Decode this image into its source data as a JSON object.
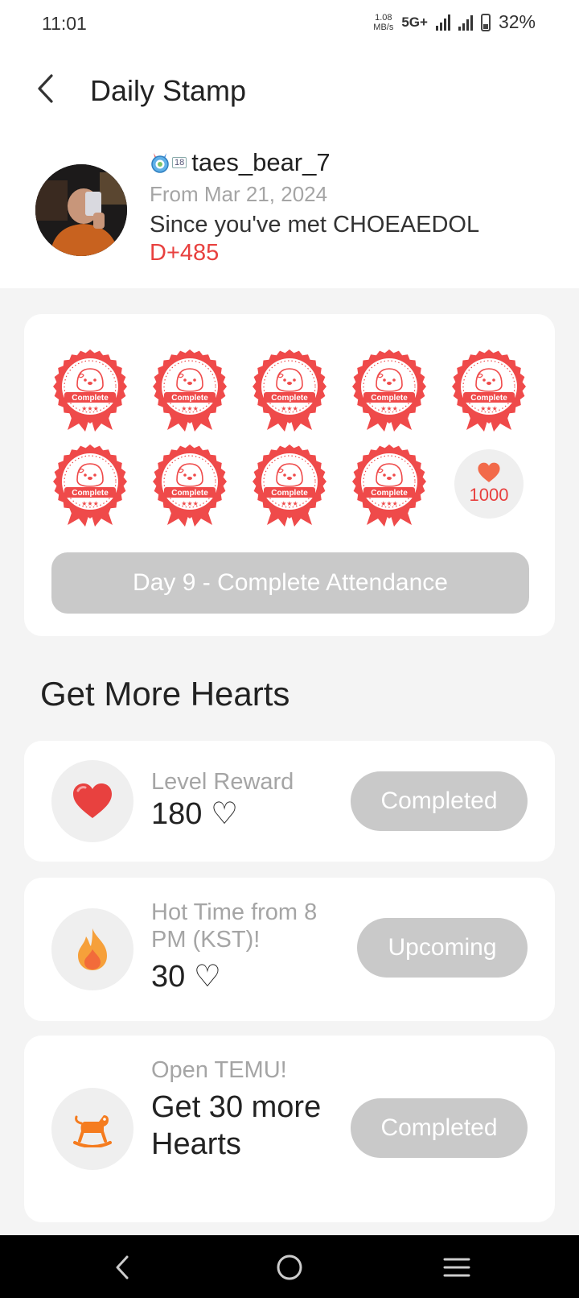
{
  "status": {
    "time": "11:01",
    "net_speed_value": "1.08",
    "net_speed_unit": "MB/s",
    "network": "5G+",
    "battery": "32%"
  },
  "header": {
    "title": "Daily Stamp"
  },
  "profile": {
    "level": "18",
    "username": "taes_bear_7",
    "from_date": "From Mar 21, 2024",
    "since_text": "Since you've met CHOEAEDOL",
    "dday": "D+485"
  },
  "stamps": {
    "label": "Complete",
    "completed_count": 9,
    "total": 10,
    "final_reward": "1000",
    "attend_button": "Day 9 - Complete Attendance"
  },
  "more_hearts": {
    "title": "Get More Hearts",
    "missions": [
      {
        "label": "Level Reward",
        "value": "180 ♡",
        "button": "Completed",
        "icon": "heart-icon"
      },
      {
        "label": "Hot Time from 8 PM (KST)!",
        "value": "30 ♡",
        "button": "Upcoming",
        "icon": "fire-icon"
      },
      {
        "label": "Open TEMU!",
        "value": "Get 30 more Hearts",
        "button": "Completed",
        "icon": "rocking-horse-icon"
      }
    ]
  },
  "colors": {
    "accent": "#e8413f",
    "stamp": "#ef4a4a",
    "disabled": "#c9c9c9",
    "background": "#f4f4f4"
  }
}
